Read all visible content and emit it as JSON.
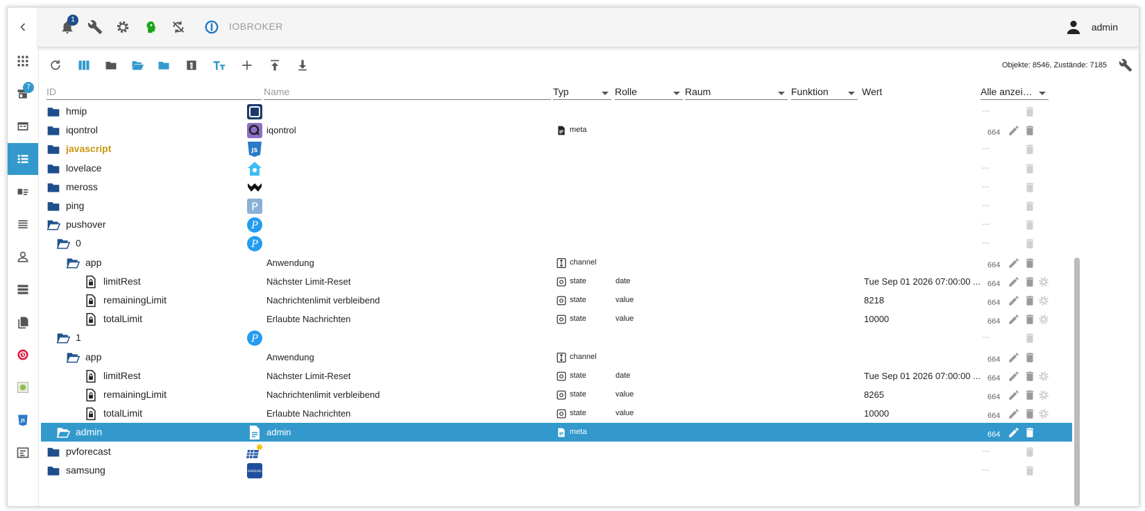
{
  "header": {
    "back_icon": "chevron-left-icon",
    "notification_count": "1",
    "brand_label": "IOBROKER",
    "user_name": "admin"
  },
  "nav": {
    "adapters_update_count": "7",
    "items": [
      "apps-grid-icon",
      "adapters-store-icon",
      "instances-icon",
      "objects-list-icon",
      "enums-icon",
      "logs-icon",
      "users-icon",
      "hosts-icon",
      "files-icon",
      "backitup-icon",
      "history-icon",
      "javascript-icon",
      "vis-icon"
    ]
  },
  "toolbar": {
    "counts": "Objekte: 8546, Zustände: 7185"
  },
  "columns": {
    "id": "ID",
    "name": "Name",
    "typ": "Typ",
    "rolle": "Rolle",
    "raum": "Raum",
    "funktion": "Funktion",
    "wert": "Wert",
    "filter": "Alle anzei…"
  },
  "colors": {
    "accent": "#3399cc",
    "folder": "#1e4f8c",
    "js_label": "#c8980f"
  },
  "rows": [
    {
      "id": "hmip",
      "indent": 0,
      "icon": "folder",
      "name": "",
      "typ": "",
      "rolle": "",
      "wert": "",
      "acl": "---",
      "adapter": "hmip",
      "edit": false,
      "gear": false
    },
    {
      "id": "iqontrol",
      "indent": 0,
      "icon": "folder",
      "name": "iqontrol",
      "typ": "meta",
      "rolle": "",
      "wert": "",
      "acl": "664",
      "adapter": "iqontrol",
      "edit": true,
      "gear": false
    },
    {
      "id": "javascript",
      "indent": 0,
      "icon": "folder",
      "name": "",
      "typ": "",
      "rolle": "",
      "wert": "",
      "acl": "---",
      "adapter": "javascript",
      "edit": false,
      "gear": false
    },
    {
      "id": "lovelace",
      "indent": 0,
      "icon": "folder",
      "name": "",
      "typ": "",
      "rolle": "",
      "wert": "",
      "acl": "---",
      "adapter": "lovelace",
      "edit": false,
      "gear": false
    },
    {
      "id": "meross",
      "indent": 0,
      "icon": "folder",
      "name": "",
      "typ": "",
      "rolle": "",
      "wert": "",
      "acl": "---",
      "adapter": "meross",
      "edit": false,
      "gear": false
    },
    {
      "id": "ping",
      "indent": 0,
      "icon": "folder",
      "name": "",
      "typ": "",
      "rolle": "",
      "wert": "",
      "acl": "---",
      "adapter": "ping",
      "edit": false,
      "gear": false
    },
    {
      "id": "pushover",
      "indent": 0,
      "icon": "folder-open",
      "name": "",
      "typ": "",
      "rolle": "",
      "wert": "",
      "acl": "---",
      "adapter": "pushover",
      "edit": false,
      "gear": false
    },
    {
      "id": "0",
      "indent": 1,
      "icon": "folder-open",
      "name": "",
      "typ": "",
      "rolle": "",
      "wert": "",
      "acl": "---",
      "adapter": "pushover",
      "edit": false,
      "gear": false
    },
    {
      "id": "app",
      "indent": 2,
      "icon": "folder-open",
      "name": "Anwendung",
      "typ": "channel",
      "rolle": "",
      "wert": "",
      "acl": "664",
      "adapter": "",
      "edit": true,
      "gear": false
    },
    {
      "id": "limitRest",
      "indent": 3,
      "icon": "file-lock",
      "name": "Nächster Limit-Reset",
      "typ": "state",
      "rolle": "date",
      "wert": "Tue Sep 01 2026 07:00:00 ...",
      "acl": "664",
      "adapter": "",
      "edit": true,
      "gear": true
    },
    {
      "id": "remainingLimit",
      "indent": 3,
      "icon": "file-lock",
      "name": "Nachrichtenlimit verbleibend",
      "typ": "state",
      "rolle": "value",
      "wert": "8218",
      "acl": "664",
      "adapter": "",
      "edit": true,
      "gear": true
    },
    {
      "id": "totalLimit",
      "indent": 3,
      "icon": "file-lock",
      "name": "Erlaubte Nachrichten",
      "typ": "state",
      "rolle": "value",
      "wert": "10000",
      "acl": "664",
      "adapter": "",
      "edit": true,
      "gear": true
    },
    {
      "id": "1",
      "indent": 1,
      "icon": "folder-open",
      "name": "",
      "typ": "",
      "rolle": "",
      "wert": "",
      "acl": "---",
      "adapter": "pushover",
      "edit": false,
      "gear": false
    },
    {
      "id": "app",
      "indent": 2,
      "icon": "folder-open",
      "name": "Anwendung",
      "typ": "channel",
      "rolle": "",
      "wert": "",
      "acl": "664",
      "adapter": "",
      "edit": true,
      "gear": false
    },
    {
      "id": "limitRest",
      "indent": 3,
      "icon": "file-lock",
      "name": "Nächster Limit-Reset",
      "typ": "state",
      "rolle": "date",
      "wert": "Tue Sep 01 2026 07:00:00 ...",
      "acl": "664",
      "adapter": "",
      "edit": true,
      "gear": true
    },
    {
      "id": "remainingLimit",
      "indent": 3,
      "icon": "file-lock",
      "name": "Nachrichtenlimit verbleibend",
      "typ": "state",
      "rolle": "value",
      "wert": "8265",
      "acl": "664",
      "adapter": "",
      "edit": true,
      "gear": true
    },
    {
      "id": "totalLimit",
      "indent": 3,
      "icon": "file-lock",
      "name": "Erlaubte Nachrichten",
      "typ": "state",
      "rolle": "value",
      "wert": "10000",
      "acl": "664",
      "adapter": "",
      "edit": true,
      "gear": true
    },
    {
      "id": "admin",
      "indent": 1,
      "icon": "folder-open",
      "name": "admin",
      "typ": "meta",
      "rolle": "",
      "wert": "",
      "acl": "664",
      "adapter": "admin",
      "edit": true,
      "gear": false,
      "selected": true
    },
    {
      "id": "pvforecast",
      "indent": 0,
      "icon": "folder",
      "name": "",
      "typ": "",
      "rolle": "",
      "wert": "",
      "acl": "---",
      "adapter": "pvforecast",
      "edit": false,
      "gear": false
    },
    {
      "id": "samsung",
      "indent": 0,
      "icon": "folder",
      "name": "",
      "typ": "",
      "rolle": "",
      "wert": "",
      "acl": "---",
      "adapter": "samsung",
      "edit": false,
      "gear": false
    }
  ]
}
